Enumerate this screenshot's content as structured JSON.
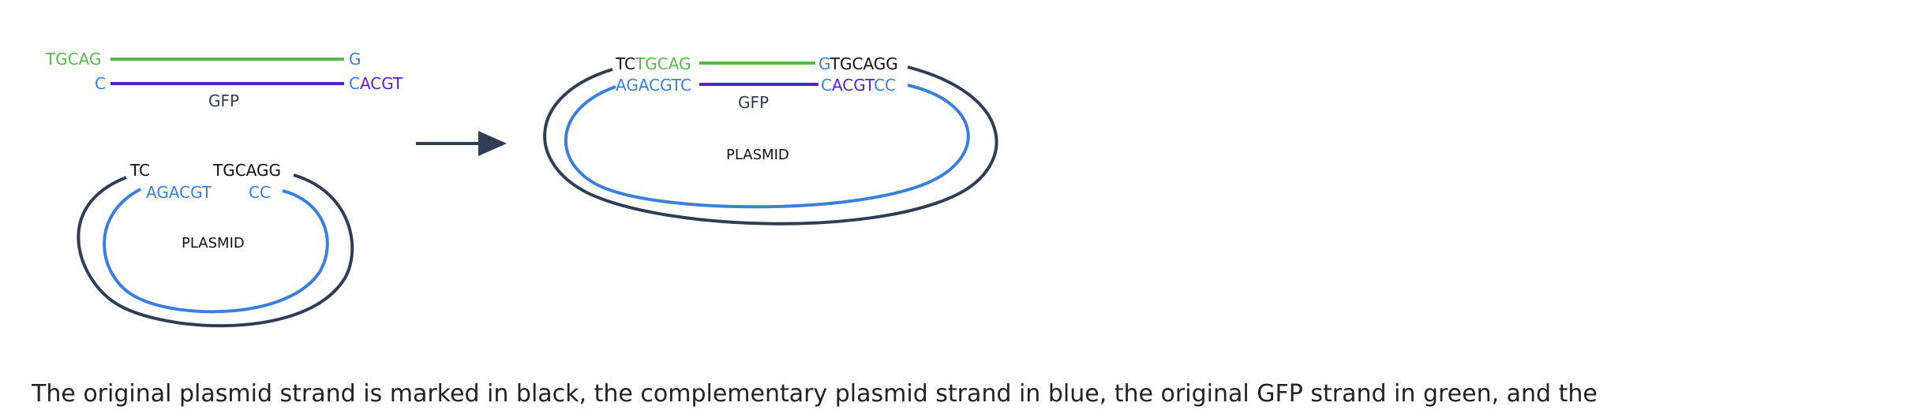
{
  "colors": {
    "black": "#111111",
    "blue": "#3a7fdc",
    "green": "#59b84a",
    "purple": "#5a1fc4",
    "navy": "#2f3e55"
  },
  "left": {
    "gfp_top_left": "TGCAG",
    "gfp_top_right": "G",
    "gfp_bottom_left": "C",
    "gfp_bottom_right_c": "C",
    "gfp_bottom_right": "ACGT",
    "gfp_label": "GFP",
    "plasmid_top_left": "TC",
    "plasmid_top_right": "TGCAGG",
    "plasmid_bottom_left": "AGACGT",
    "plasmid_bottom_right": "CC",
    "plasmid_label": "PLASMID"
  },
  "right": {
    "top_tc": "TC",
    "top_tgcag": "TGCAG",
    "top_g": "G",
    "top_tgcagg": "TGCAGG",
    "bottom_agacgtc": "AGACGTC",
    "bottom_c": "C",
    "bottom_acgt": "ACGT",
    "bottom_cc": "CC",
    "gfp_label": "GFP",
    "plasmid_label": "PLASMID"
  },
  "caption": "The original plasmid strand is marked in black, the complementary plasmid strand in blue, the original GFP strand in green, and the"
}
